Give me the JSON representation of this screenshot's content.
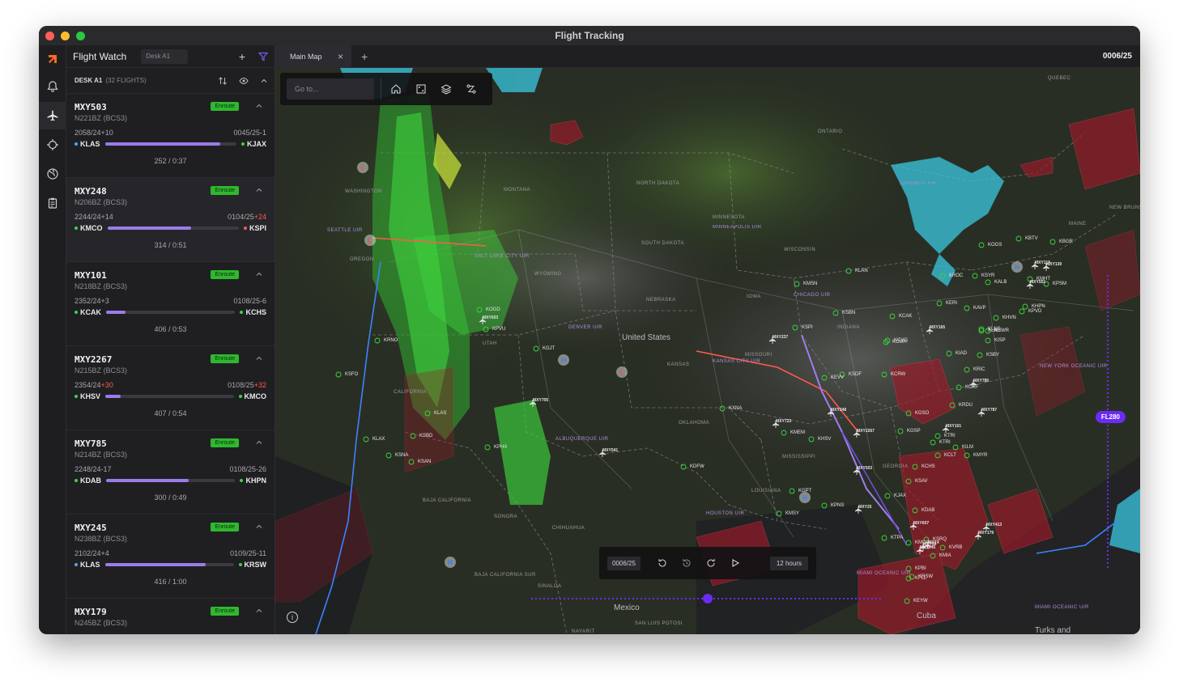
{
  "window": {
    "title": "Flight Tracking",
    "colors": {
      "close": "#ff5f57",
      "minimize": "#febc2e",
      "maximize": "#28c840"
    }
  },
  "sidebar": {
    "app_name": "Flight Watch",
    "desk_input_value": "Desk A1",
    "desk_label": "DESK A1",
    "desk_count": "(32 FLIGHTS)",
    "flights": [
      {
        "callsign": "MXY503",
        "tail": "N221BZ (BCS3)",
        "status": "Enroute",
        "dep_time": "2058/24",
        "dep_delta": "+10",
        "arr_time": "0045/25",
        "arr_delta": "-1",
        "origin": "KLAS",
        "dest": "KJAX",
        "progress": 0.88,
        "stat": "252 / 0:37",
        "dep_late": false,
        "arr_late": false
      },
      {
        "callsign": "MXY248",
        "tail": "N206BZ (BCS3)",
        "status": "Enroute",
        "dep_time": "2244/24",
        "dep_delta": "+14",
        "arr_time": "0104/25",
        "arr_delta": "+24",
        "origin": "KMCO",
        "dest": "KSPI",
        "progress": 0.64,
        "stat": "314  /  0:51",
        "dep_late": false,
        "arr_late": true
      },
      {
        "callsign": "MXY101",
        "tail": "N218BZ (BCS3)",
        "status": "Enroute",
        "dep_time": "2352/24",
        "dep_delta": "+3",
        "arr_time": "0108/25",
        "arr_delta": "-6",
        "origin": "KCAK",
        "dest": "KCHS",
        "progress": 0.15,
        "stat": "406  /  0:53",
        "dep_late": false,
        "arr_late": false
      },
      {
        "callsign": "MXY2267",
        "tail": "N215BZ (BCS3)",
        "status": "Enroute",
        "dep_time": "2354/24",
        "dep_delta": "+30",
        "arr_time": "0108/25",
        "arr_delta": "+32",
        "origin": "KHSV",
        "dest": "KMCO",
        "progress": 0.12,
        "stat": "407  /  0:54",
        "dep_late": true,
        "arr_late": true
      },
      {
        "callsign": "MXY785",
        "tail": "N214BZ (BCS3)",
        "status": "Enroute",
        "dep_time": "2248/24",
        "dep_delta": "-17",
        "arr_time": "0108/25",
        "arr_delta": "-26",
        "origin": "KDAB",
        "dest": "KHPN",
        "progress": 0.64,
        "stat": "300  /  0:49",
        "dep_late": false,
        "arr_late": false
      },
      {
        "callsign": "MXY245",
        "tail": "N238BZ (BCS3)",
        "status": "Enroute",
        "dep_time": "2102/24",
        "dep_delta": "+4",
        "arr_time": "0109/25",
        "arr_delta": "-11",
        "origin": "KLAS",
        "dest": "KRSW",
        "progress": 0.78,
        "stat": "416  /  1:00",
        "dep_late": false,
        "arr_late": false
      },
      {
        "callsign": "MXY179",
        "tail": "N245BZ (BCS3)",
        "status": "Enroute",
        "dep_time": "",
        "dep_delta": "",
        "arr_time": "",
        "arr_delta": "",
        "origin": "",
        "dest": "",
        "progress": 0,
        "stat": "",
        "dep_late": false,
        "arr_late": false
      }
    ]
  },
  "tabs": {
    "main_tab": "Main Map",
    "clock": "0006/25"
  },
  "map": {
    "search_placeholder": "Go to...",
    "timeline_time": "0006/25",
    "timeline_range": "12 hours",
    "flight_level_badge": "FL280",
    "country_labels": {
      "us": "United States",
      "mexico": "Mexico",
      "cuba": "Cuba",
      "turks": "Turks and"
    },
    "region_labels": [
      {
        "id": "washington",
        "text": "WASHINGTON"
      },
      {
        "id": "montana",
        "text": "MONTANA"
      },
      {
        "id": "north-dakota",
        "text": "NORTH DAKOTA"
      },
      {
        "id": "south-dakota",
        "text": "SOUTH DAKOTA"
      },
      {
        "id": "minnesota",
        "text": "MINNESOTA"
      },
      {
        "id": "wisconsin",
        "text": "WISCONSIN"
      },
      {
        "id": "ontario",
        "text": "ONTARIO"
      },
      {
        "id": "quebec",
        "text": "QUEBEC"
      },
      {
        "id": "maine",
        "text": "MAINE"
      },
      {
        "id": "new-brunswick",
        "text": "NEW BRUNSWI"
      },
      {
        "id": "oregon",
        "text": "OREGON"
      },
      {
        "id": "wyoming",
        "text": "WYOMING"
      },
      {
        "id": "nebraska",
        "text": "NEBRASKA"
      },
      {
        "id": "iowa",
        "text": "IOWA"
      },
      {
        "id": "utah",
        "text": "UTAH"
      },
      {
        "id": "kansas",
        "text": "KANSAS"
      },
      {
        "id": "missouri",
        "text": "MISSOURI"
      },
      {
        "id": "indiana",
        "text": "INDIANA"
      },
      {
        "id": "oklahoma",
        "text": "OKLAHOMA"
      },
      {
        "id": "mississippi",
        "text": "MISSISSIPPI"
      },
      {
        "id": "georgia",
        "text": "GEORGIA"
      },
      {
        "id": "louisiana",
        "text": "LOUISIANA"
      },
      {
        "id": "california",
        "text": "CALIFORNIA"
      },
      {
        "id": "chihuahua",
        "text": "CHIHUAHUA"
      },
      {
        "id": "sonora",
        "text": "SONORA"
      },
      {
        "id": "baja-california",
        "text": "BAJA CALIFORNIA"
      },
      {
        "id": "baja-california-sur",
        "text": "BAJA CALIFORNIA SUR"
      },
      {
        "id": "sinaloa",
        "text": "SINALOA"
      },
      {
        "id": "san-luis",
        "text": "SAN LUIS POTOSI"
      },
      {
        "id": "nayarit",
        "text": "NAYARIT"
      }
    ],
    "uir_labels": [
      {
        "id": "seattle",
        "text": "SEATTLE UIR"
      },
      {
        "id": "salt-lake",
        "text": "SALT LAKE CITY UIR"
      },
      {
        "id": "denver",
        "text": "DENVER UIR"
      },
      {
        "id": "minneapolis",
        "text": "MINNEAPOLIS UIR"
      },
      {
        "id": "chicago",
        "text": "CHICAGO UIR"
      },
      {
        "id": "kansas-city",
        "text": "KANSAS CITY UIR"
      },
      {
        "id": "albuquerque",
        "text": "ALBUQUERQUE UIR"
      },
      {
        "id": "houston",
        "text": "HOUSTON UIR"
      },
      {
        "id": "toronto",
        "text": "TORONTO FIR"
      },
      {
        "id": "new-york-oceanic",
        "text": "NEW YORK OCEANIC UIR"
      },
      {
        "id": "miami-oceanic",
        "text": "MIAMI OCEANIC UIR"
      },
      {
        "id": "miami-oceanic-2",
        "text": "MIAMI OCEANIC UIR"
      }
    ],
    "airports": [
      "KOGD",
      "KPVU",
      "KRNO",
      "KSFO",
      "KLAS",
      "KSBD",
      "KLAX",
      "KSNA",
      "KSAN",
      "KPHX",
      "KGJT",
      "KDFW",
      "KXNA",
      "KMEM",
      "KHSV",
      "KGPT",
      "KMSY",
      "KPNS",
      "KTPA",
      "KRSW",
      "KMCO",
      "KPBI",
      "KFLL",
      "KEYW",
      "KJAX",
      "KSAV",
      "KCHS",
      "KGSO",
      "KRDU",
      "KORF",
      "KRIC",
      "KIAD",
      "KSBY",
      "KEWR",
      "KISP",
      "KHVN",
      "KPVD",
      "KALB",
      "KSYR",
      "KROC",
      "KOGS",
      "KBTV",
      "KBGR",
      "KCAK",
      "KCMH",
      "KCVG",
      "KSDF",
      "KEVV",
      "KMSN",
      "KLAN",
      "KSBN",
      "KSPI",
      "KERI",
      "KAVP",
      "KLNS",
      "KHPN",
      "KMHT",
      "KPSM",
      "KTRI",
      "KGSP",
      "KCLT",
      "KILM",
      "KMYR",
      "KDAB",
      "KSRQ",
      "KMIA",
      "KCRW",
      "KTRI",
      "KLNS",
      "KVRB"
    ],
    "flight_labels": [
      "MXY603",
      "MXY705",
      "MXY541",
      "MXY237",
      "MXY248",
      "MXY723",
      "MXY503",
      "MXY2267",
      "MXY785",
      "MXY787",
      "MXY101",
      "MXY413",
      "MXY607",
      "MXY49",
      "MXY165",
      "MXY119",
      "MXY25",
      "MXY139",
      "MXY4",
      "MXY551",
      "MXY245",
      "MXY179"
    ],
    "weather_colors": {
      "green": "#3ed43e",
      "cyan": "#39c8e0",
      "red_zone": "#a01a2a",
      "purple_route": "#8d5cf0"
    }
  }
}
